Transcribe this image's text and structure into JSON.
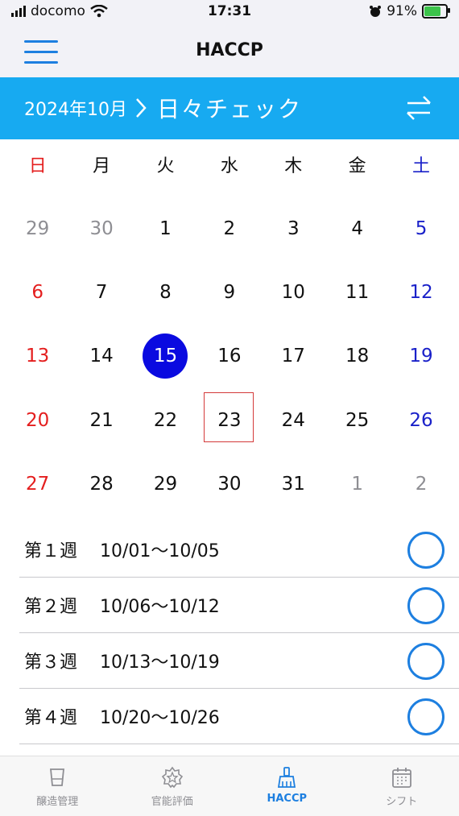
{
  "status": {
    "carrier": "docomo",
    "time": "17:31",
    "battery": "91%",
    "battery_level": 0.91
  },
  "navbar": {
    "title": "HACCP"
  },
  "header": {
    "month": "2024年10月",
    "title": "日々チェック"
  },
  "weekdays": [
    "日",
    "月",
    "火",
    "水",
    "木",
    "金",
    "土"
  ],
  "calendar": {
    "rows": [
      [
        {
          "d": "29",
          "o": true
        },
        {
          "d": "30",
          "o": true
        },
        {
          "d": "1"
        },
        {
          "d": "2"
        },
        {
          "d": "3"
        },
        {
          "d": "4"
        },
        {
          "d": "5"
        }
      ],
      [
        {
          "d": "6"
        },
        {
          "d": "7"
        },
        {
          "d": "8"
        },
        {
          "d": "9"
        },
        {
          "d": "10"
        },
        {
          "d": "11"
        },
        {
          "d": "12"
        }
      ],
      [
        {
          "d": "13"
        },
        {
          "d": "14"
        },
        {
          "d": "15",
          "sel": true
        },
        {
          "d": "16"
        },
        {
          "d": "17"
        },
        {
          "d": "18"
        },
        {
          "d": "19"
        }
      ],
      [
        {
          "d": "20"
        },
        {
          "d": "21"
        },
        {
          "d": "22"
        },
        {
          "d": "23",
          "today": true
        },
        {
          "d": "24"
        },
        {
          "d": "25"
        },
        {
          "d": "26"
        }
      ],
      [
        {
          "d": "27"
        },
        {
          "d": "28"
        },
        {
          "d": "29"
        },
        {
          "d": "30"
        },
        {
          "d": "31"
        },
        {
          "d": "1",
          "o": true
        },
        {
          "d": "2",
          "o": true
        }
      ]
    ]
  },
  "weeks": [
    {
      "label": "第１週",
      "range": "10/01〜10/05"
    },
    {
      "label": "第２週",
      "range": "10/06〜10/12"
    },
    {
      "label": "第３週",
      "range": "10/13〜10/19"
    },
    {
      "label": "第４週",
      "range": "10/20〜10/26"
    }
  ],
  "tabs": [
    {
      "label": "醸造管理",
      "icon": "cup-icon",
      "active": false
    },
    {
      "label": "官能評価",
      "icon": "star-badge-icon",
      "active": false
    },
    {
      "label": "HACCP",
      "icon": "brush-icon",
      "active": true
    },
    {
      "label": "シフト",
      "icon": "calendar-icon",
      "active": false
    }
  ],
  "colors": {
    "accent": "#1d7fe0",
    "header": "#17aaf1",
    "sunday": "#e41e1e",
    "saturday": "#1a21c9",
    "selected": "#0a0ae0"
  }
}
